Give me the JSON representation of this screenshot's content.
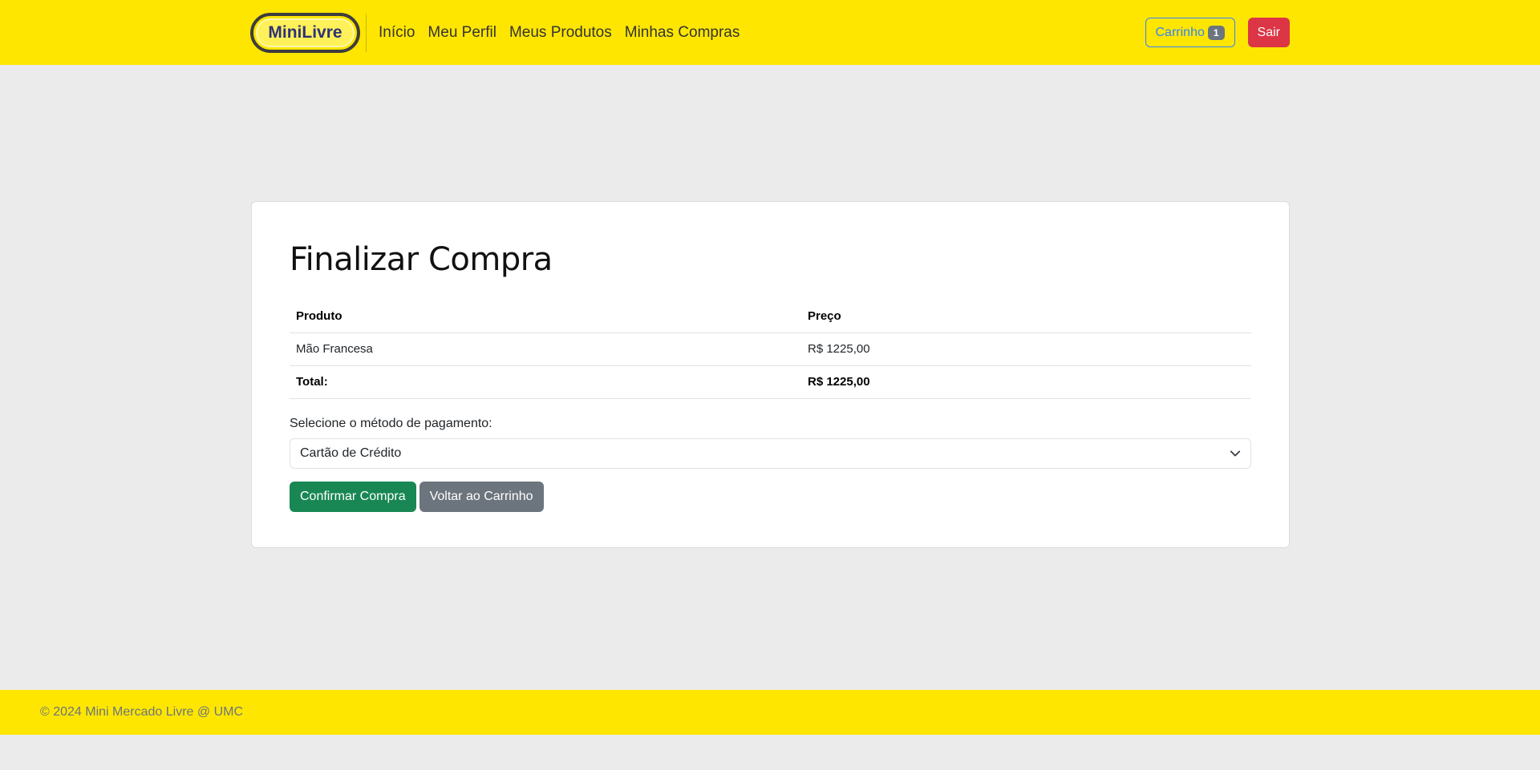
{
  "navbar": {
    "brand": "MiniLivre",
    "links": [
      "Início",
      "Meu Perfil",
      "Meus Produtos",
      "Minhas Compras"
    ],
    "cart_label": "Carrinho",
    "cart_count": "1",
    "logout_label": "Sair"
  },
  "checkout": {
    "title": "Finalizar Compra",
    "table": {
      "headers": [
        "Produto",
        "Preço"
      ],
      "rows": [
        [
          "Mão Francesa",
          "R$ 1225,00"
        ]
      ],
      "total_label": "Total:",
      "total_value": "R$ 1225,00"
    },
    "payment_label": "Selecione o método de pagamento:",
    "payment_selected": "Cartão de Crédito",
    "confirm_label": "Confirmar Compra",
    "back_label": "Voltar ao Carrinho"
  },
  "footer": {
    "text": "© 2024 Mini Mercado Livre @ UMC"
  },
  "colors": {
    "brand_yellow": "#ffe600",
    "cart_blue": "#3483fa",
    "danger": "#dc3545",
    "success": "#198754",
    "secondary": "#6c757d"
  },
  "icons": {
    "select_caret": "chevron-down-icon"
  }
}
